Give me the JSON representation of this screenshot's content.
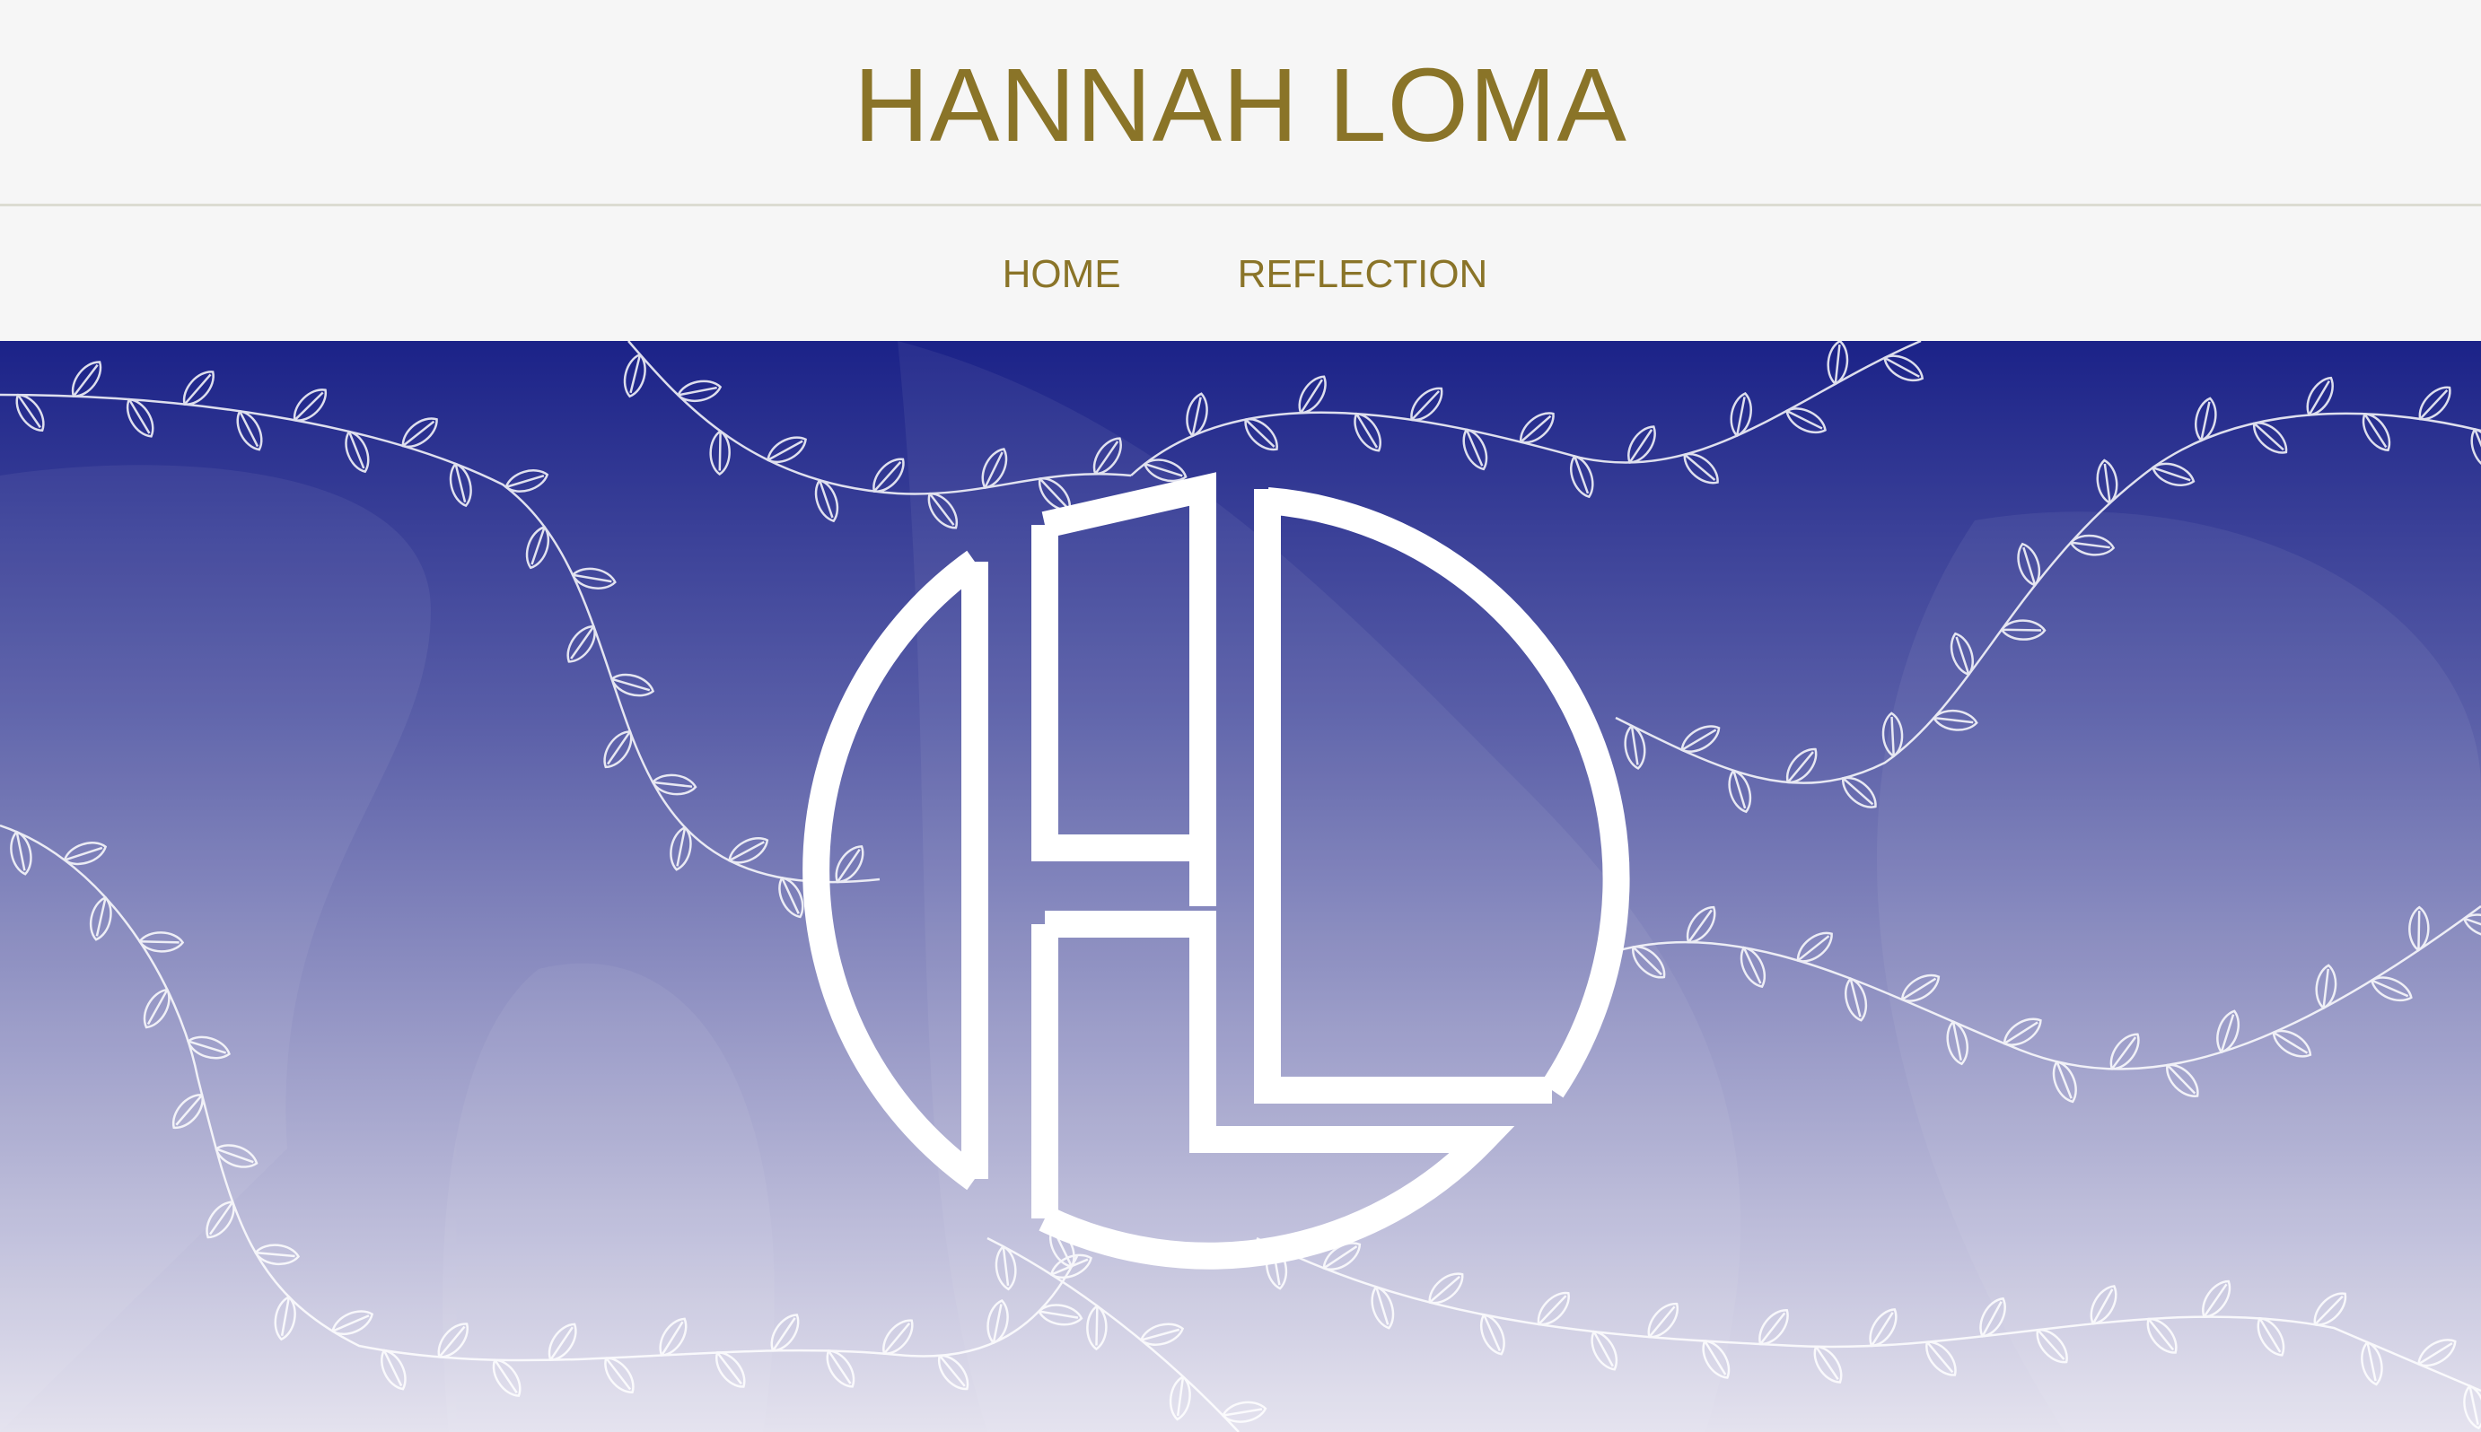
{
  "site": {
    "title": "HANNAH LOMA"
  },
  "nav": {
    "items": [
      {
        "label": "HOME"
      },
      {
        "label": "REFLECTION"
      }
    ]
  },
  "hero": {
    "logo_icon": "hl-monogram-logo",
    "background_icon": "leafy-vines-pattern"
  },
  "colors": {
    "accent": "#8a7428",
    "header_bg": "#f6f6f6",
    "hero_top": "#1b2288",
    "hero_bottom": "#e4e2ee",
    "logo": "#ffffff"
  }
}
